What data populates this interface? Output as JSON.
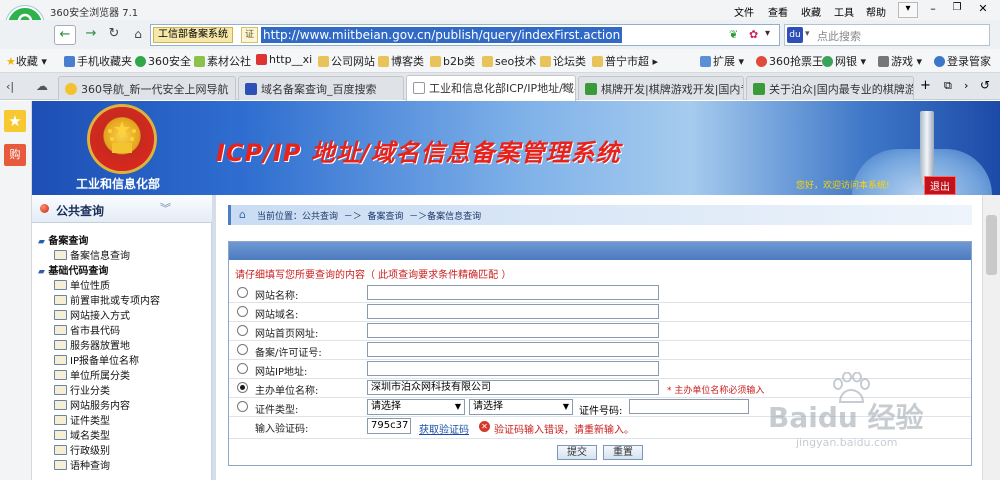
{
  "browser": {
    "title": "360安全浏览器 7.1",
    "menu": [
      "文件",
      "查看",
      "收藏",
      "工具",
      "帮助"
    ],
    "zone_label": "工信部备案系统",
    "cert_mark": "证",
    "url": "http://www.miitbeian.gov.cn/publish/query/indexFirst.action",
    "search_placeholder": "点此搜索",
    "favorites": {
      "collect": "收藏",
      "items": [
        "手机收藏夹",
        "360安全",
        "素材公社",
        "http__xi",
        "公司网站",
        "博客类",
        "b2b类",
        "seo技术",
        "论坛类",
        "普宁市超"
      ],
      "right": [
        "扩展",
        "360抢票王",
        "网银",
        "游戏",
        "登录管家"
      ]
    },
    "tabs": [
      {
        "label": "360导航_新一代安全上网导航"
      },
      {
        "label": "域名备案查询_百度搜索"
      },
      {
        "label": "工业和信息化部ICP/IP地址/域名信息备案管理系统"
      },
      {
        "label": "棋牌开发|棋牌游戏开发|国内专业"
      },
      {
        "label": "关于泊众|国内最专业的棋牌游戏"
      }
    ]
  },
  "banner": {
    "ministry": "工业和信息化部",
    "title": "ICP/IP 地址/域名信息备案管理系统",
    "welcome": "您好，欢迎访问本系统!",
    "logout": "退出"
  },
  "sidebar": {
    "title": "公共查询",
    "groups": [
      {
        "label": "备案查询",
        "items": [
          "备案信息查询"
        ]
      },
      {
        "label": "基础代码查询",
        "items": [
          "单位性质",
          "前置审批或专项内容",
          "网站接入方式",
          "省市县代码",
          "服务器放置地",
          "IP报备单位名称",
          "单位所属分类",
          "行业分类",
          "网站服务内容",
          "证件类型",
          "域名类型",
          "行政级别",
          "语种查询"
        ]
      }
    ]
  },
  "main": {
    "breadcrumb": "当前位置：公共查询  －＞  备案查询  －＞备案信息查询",
    "instruction": "请仔细填写您所要查询的内容（ 此项查询要求条件精确匹配 ）",
    "fields": [
      {
        "label": "网站名称:",
        "value": ""
      },
      {
        "label": "网站域名:",
        "value": ""
      },
      {
        "label": "网站首页网址:",
        "value": ""
      },
      {
        "label": "备案/许可证号:",
        "value": ""
      },
      {
        "label": "网站IP地址:",
        "value": ""
      },
      {
        "label": "主办单位名称:",
        "value": "深圳市泊众网科技有限公司",
        "note": "* 主办单位名称必须输入"
      }
    ],
    "cert": {
      "label": "证件类型:",
      "select1": "请选择",
      "select2": "请选择",
      "number_label": "证件号码:",
      "number_value": ""
    },
    "captcha": {
      "label": "输入验证码:",
      "value": "795c37",
      "get_link": "获取验证码",
      "error": "验证码输入错误，请重新输入。"
    },
    "submit": "提交",
    "reset": "重置"
  },
  "watermark": {
    "brand": "Baidu 经验",
    "url": "jingyan.baidu.com"
  },
  "colors": {
    "accent": "#1a5fb4",
    "banner_title": "#e8221b",
    "error": "#c81e1e",
    "link": "#1a4fa8"
  }
}
